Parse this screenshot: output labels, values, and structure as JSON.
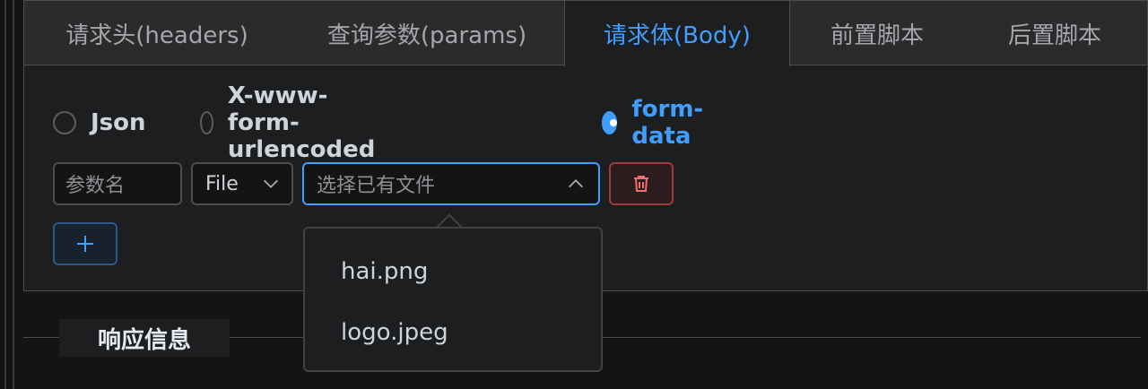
{
  "tabs": [
    {
      "label": "请求头(headers)",
      "active": false
    },
    {
      "label": "查询参数(params)",
      "active": false
    },
    {
      "label": "请求体(Body)",
      "active": true
    },
    {
      "label": "前置脚本",
      "active": false
    },
    {
      "label": "后置脚本",
      "active": false
    }
  ],
  "body_types": {
    "json": "Json",
    "urlencoded": "X-www-form-urlencoded",
    "formdata": "form-data",
    "selected": "form-data"
  },
  "form_row": {
    "param_name_placeholder": "参数名",
    "type_value": "File",
    "file_placeholder": "选择已有文件"
  },
  "file_options": [
    "hai.png",
    "logo.jpeg"
  ],
  "response": {
    "title": "响应信息"
  },
  "colors": {
    "accent": "#409eff",
    "danger": "#f56c6c"
  }
}
